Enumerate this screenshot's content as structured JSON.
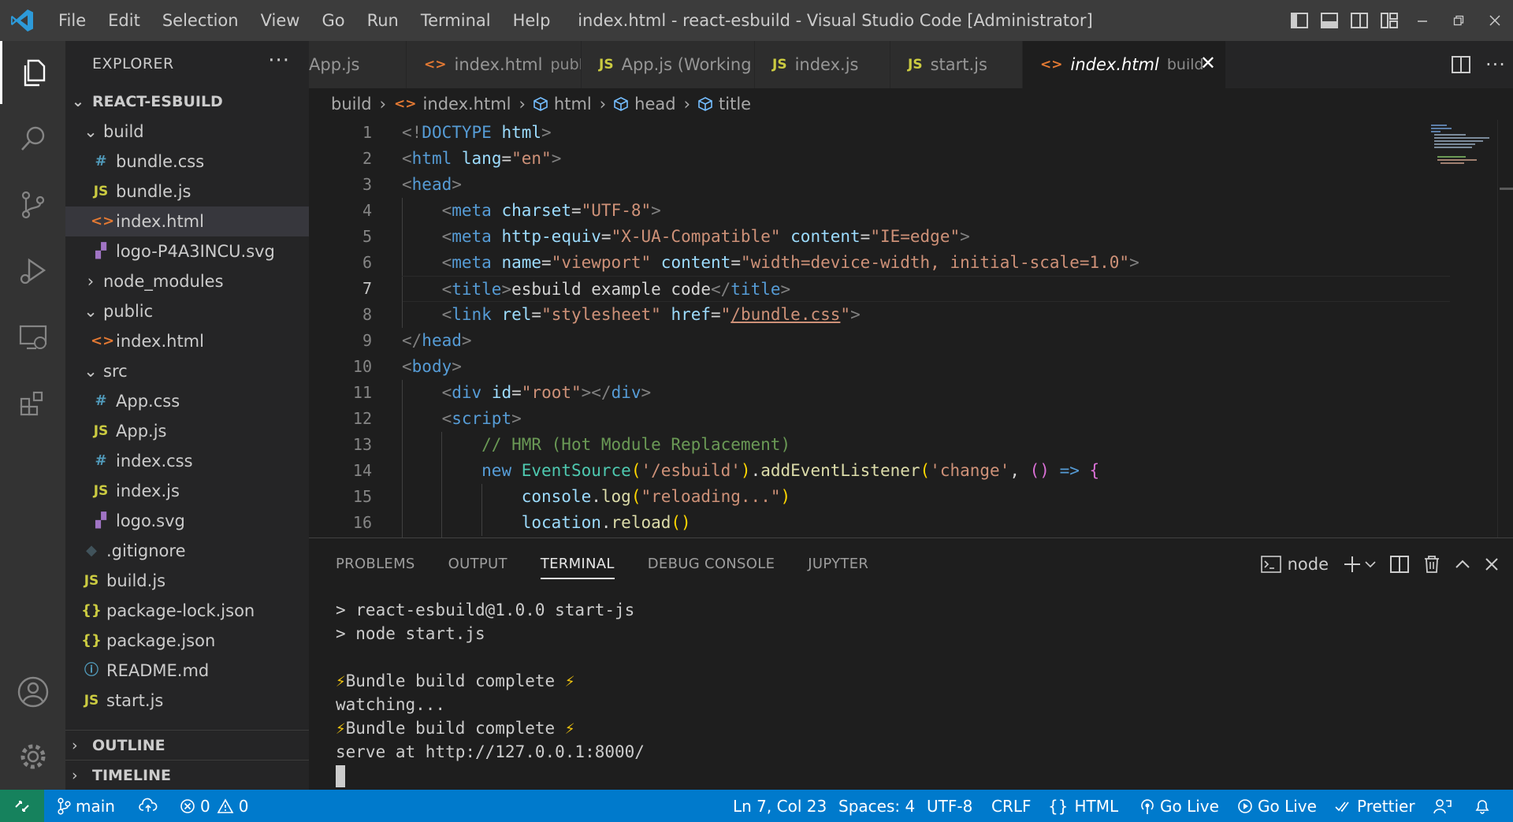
{
  "titlebar": {
    "menu": [
      "File",
      "Edit",
      "Selection",
      "View",
      "Go",
      "Run",
      "Terminal",
      "Help"
    ],
    "title": "index.html - react-esbuild - Visual Studio Code [Administrator]"
  },
  "sidebar": {
    "title": "EXPLORER",
    "root": "REACT-ESBUILD",
    "tree": [
      {
        "name": "build",
        "icon": "folder",
        "level": 1,
        "open": true
      },
      {
        "name": "bundle.css",
        "icon": "css",
        "level": 2
      },
      {
        "name": "bundle.js",
        "icon": "js",
        "level": 2
      },
      {
        "name": "index.html",
        "icon": "html",
        "level": 2,
        "selected": true
      },
      {
        "name": "logo-P4A3INCU.svg",
        "icon": "svg",
        "level": 2
      },
      {
        "name": "node_modules",
        "icon": "folder",
        "level": 1,
        "open": false
      },
      {
        "name": "public",
        "icon": "folder",
        "level": 1,
        "open": true
      },
      {
        "name": "index.html",
        "icon": "html",
        "level": 2
      },
      {
        "name": "src",
        "icon": "folder",
        "level": 1,
        "open": true
      },
      {
        "name": "App.css",
        "icon": "css",
        "level": 2
      },
      {
        "name": "App.js",
        "icon": "js",
        "level": 2
      },
      {
        "name": "index.css",
        "icon": "css",
        "level": 2
      },
      {
        "name": "index.js",
        "icon": "js",
        "level": 2
      },
      {
        "name": "logo.svg",
        "icon": "svg",
        "level": 2
      },
      {
        "name": ".gitignore",
        "icon": "git",
        "level": 1
      },
      {
        "name": "build.js",
        "icon": "js",
        "level": 1
      },
      {
        "name": "package-lock.json",
        "icon": "json",
        "level": 1
      },
      {
        "name": "package.json",
        "icon": "json",
        "level": 1
      },
      {
        "name": "README.md",
        "icon": "info",
        "level": 1
      },
      {
        "name": "start.js",
        "icon": "js",
        "level": 1
      }
    ],
    "outline": "OUTLINE",
    "timeline": "TIMELINE"
  },
  "tabs": [
    {
      "name": "App.js",
      "desc": "",
      "icon": "js",
      "hide_icon": true
    },
    {
      "name": "index.html",
      "desc": "public",
      "icon": "html"
    },
    {
      "name": "App.js (Working Tree)",
      "desc": "",
      "icon": "js"
    },
    {
      "name": "index.js",
      "desc": "",
      "icon": "js"
    },
    {
      "name": "start.js",
      "desc": "",
      "icon": "js"
    },
    {
      "name": "index.html",
      "desc": "build",
      "icon": "html",
      "active": true
    }
  ],
  "breadcrumb": [
    {
      "label": "build",
      "icon": ""
    },
    {
      "label": "index.html",
      "icon": "html"
    },
    {
      "label": "html",
      "icon": "cube"
    },
    {
      "label": "head",
      "icon": "cube"
    },
    {
      "label": "title",
      "icon": "cube"
    }
  ],
  "editor": {
    "current_line": 7,
    "lines": [
      [
        [
          "p",
          "<!"
        ],
        [
          "t",
          "DOCTYPE"
        ],
        [
          "d",
          " "
        ],
        [
          "a",
          "html"
        ],
        [
          "p",
          ">"
        ]
      ],
      [
        [
          "p",
          "<"
        ],
        [
          "t",
          "html"
        ],
        [
          "d",
          " "
        ],
        [
          "a",
          "lang"
        ],
        [
          "d",
          "="
        ],
        [
          "s",
          "\"en\""
        ],
        [
          "p",
          ">"
        ]
      ],
      [
        [
          "p",
          "<"
        ],
        [
          "t",
          "head"
        ],
        [
          "p",
          ">"
        ]
      ],
      [
        [
          "d",
          "    "
        ],
        [
          "p",
          "<"
        ],
        [
          "t",
          "meta"
        ],
        [
          "d",
          " "
        ],
        [
          "a",
          "charset"
        ],
        [
          "d",
          "="
        ],
        [
          "s",
          "\"UTF-8\""
        ],
        [
          "p",
          ">"
        ]
      ],
      [
        [
          "d",
          "    "
        ],
        [
          "p",
          "<"
        ],
        [
          "t",
          "meta"
        ],
        [
          "d",
          " "
        ],
        [
          "a",
          "http-equiv"
        ],
        [
          "d",
          "="
        ],
        [
          "s",
          "\"X-UA-Compatible\""
        ],
        [
          "d",
          " "
        ],
        [
          "a",
          "content"
        ],
        [
          "d",
          "="
        ],
        [
          "s",
          "\"IE=edge\""
        ],
        [
          "p",
          ">"
        ]
      ],
      [
        [
          "d",
          "    "
        ],
        [
          "p",
          "<"
        ],
        [
          "t",
          "meta"
        ],
        [
          "d",
          " "
        ],
        [
          "a",
          "name"
        ],
        [
          "d",
          "="
        ],
        [
          "s",
          "\"viewport\""
        ],
        [
          "d",
          " "
        ],
        [
          "a",
          "content"
        ],
        [
          "d",
          "="
        ],
        [
          "s",
          "\"width=device-width, initial-scale=1.0\""
        ],
        [
          "p",
          ">"
        ]
      ],
      [
        [
          "d",
          "    "
        ],
        [
          "p",
          "<"
        ],
        [
          "t",
          "title"
        ],
        [
          "p",
          ">"
        ],
        [
          "d",
          "esbuild example code"
        ],
        [
          "p",
          "</"
        ],
        [
          "t",
          "title"
        ],
        [
          "p",
          ">"
        ]
      ],
      [
        [
          "d",
          "    "
        ],
        [
          "p",
          "<"
        ],
        [
          "t",
          "link"
        ],
        [
          "d",
          " "
        ],
        [
          "a",
          "rel"
        ],
        [
          "d",
          "="
        ],
        [
          "s",
          "\"stylesheet\""
        ],
        [
          "d",
          " "
        ],
        [
          "a",
          "href"
        ],
        [
          "d",
          "="
        ],
        [
          "s",
          "\""
        ],
        [
          "u",
          "/bundle.css"
        ],
        [
          "s",
          "\""
        ],
        [
          "p",
          ">"
        ]
      ],
      [
        [
          "p",
          "</"
        ],
        [
          "t",
          "head"
        ],
        [
          "p",
          ">"
        ]
      ],
      [
        [
          "p",
          "<"
        ],
        [
          "t",
          "body"
        ],
        [
          "p",
          ">"
        ]
      ],
      [
        [
          "d",
          "    "
        ],
        [
          "p",
          "<"
        ],
        [
          "t",
          "div"
        ],
        [
          "d",
          " "
        ],
        [
          "a",
          "id"
        ],
        [
          "d",
          "="
        ],
        [
          "s",
          "\"root\""
        ],
        [
          "p",
          "></"
        ],
        [
          "t",
          "div"
        ],
        [
          "p",
          ">"
        ]
      ],
      [
        [
          "d",
          "    "
        ],
        [
          "p",
          "<"
        ],
        [
          "t",
          "script"
        ],
        [
          "p",
          ">"
        ]
      ],
      [
        [
          "d",
          "        "
        ],
        [
          "c",
          "// HMR (Hot Module Replacement)"
        ]
      ],
      [
        [
          "d",
          "        "
        ],
        [
          "k",
          "new"
        ],
        [
          "d",
          " "
        ],
        [
          "cls",
          "EventSource"
        ],
        [
          "y",
          "("
        ],
        [
          "s",
          "'/esbuild'"
        ],
        [
          "y",
          ")"
        ],
        [
          "d",
          "."
        ],
        [
          "f",
          "addEventListener"
        ],
        [
          "y",
          "("
        ],
        [
          "s",
          "'change'"
        ],
        [
          "d",
          ", "
        ],
        [
          "m",
          "()"
        ],
        [
          "d",
          " "
        ],
        [
          "k",
          "=>"
        ],
        [
          "d",
          " "
        ],
        [
          "m",
          "{"
        ]
      ],
      [
        [
          "d",
          "            "
        ],
        [
          "a",
          "console"
        ],
        [
          "d",
          "."
        ],
        [
          "f",
          "log"
        ],
        [
          "y",
          "("
        ],
        [
          "s",
          "\"reloading...\""
        ],
        [
          "y",
          ")"
        ]
      ],
      [
        [
          "d",
          "            "
        ],
        [
          "a",
          "location"
        ],
        [
          "d",
          "."
        ],
        [
          "f",
          "reload"
        ],
        [
          "y",
          "()"
        ]
      ],
      [
        [
          "d",
          "        "
        ],
        [
          "m",
          "})"
        ]
      ]
    ]
  },
  "panel": {
    "tabs": [
      "PROBLEMS",
      "OUTPUT",
      "TERMINAL",
      "DEBUG CONSOLE",
      "JUPYTER"
    ],
    "active_tab": "TERMINAL",
    "shell": "node",
    "terminal": [
      {
        "text": "> react-esbuild@1.0.0 start-js"
      },
      {
        "text": "> node start.js"
      },
      {
        "text": ""
      },
      {
        "text": "Bundle build complete ",
        "bolt": true
      },
      {
        "text": "watching..."
      },
      {
        "text": "Bundle build complete ",
        "bolt": true
      },
      {
        "text": "serve at http://127.0.0.1:8000/"
      }
    ]
  },
  "status": {
    "branch": "main",
    "errors": "0",
    "warnings": "0",
    "position": "Ln 7, Col 23",
    "spaces": "Spaces: 4",
    "encoding": "UTF-8",
    "eol": "CRLF",
    "language": "HTML",
    "golive1": "Go Live",
    "golive2": "Go Live",
    "prettier": "Prettier"
  },
  "colors": {
    "statusbar": "#007acc",
    "remote": "#16825d",
    "activity": "#333333",
    "sidebar": "#252526",
    "editor": "#1e1e1e",
    "titlebar": "#3c3c3c"
  }
}
